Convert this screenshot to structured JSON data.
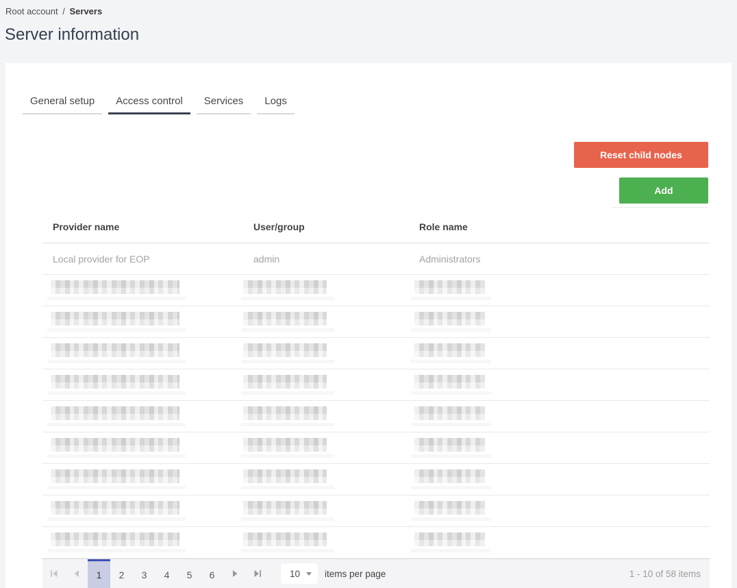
{
  "breadcrumb": {
    "parent": "Root account",
    "separator": "/",
    "current": "Servers"
  },
  "page": {
    "title": "Server information"
  },
  "tabs": [
    {
      "label": "General setup",
      "active": false
    },
    {
      "label": "Access control",
      "active": true
    },
    {
      "label": "Services",
      "active": false
    },
    {
      "label": "Logs",
      "active": false
    }
  ],
  "actions": {
    "reset": "Reset child nodes",
    "add": "Add"
  },
  "grid": {
    "columns": [
      "Provider name",
      "User/group",
      "Role name"
    ],
    "rows": [
      {
        "provider_name": "Local provider for EOP",
        "user_group": "admin",
        "role_name": "Administrators",
        "redacted": false
      },
      {
        "redacted": true
      },
      {
        "redacted": true
      },
      {
        "redacted": true
      },
      {
        "redacted": true
      },
      {
        "redacted": true
      },
      {
        "redacted": true
      },
      {
        "redacted": true
      },
      {
        "redacted": true
      },
      {
        "redacted": true
      }
    ]
  },
  "pager": {
    "pages": [
      "1",
      "2",
      "3",
      "4",
      "5",
      "6"
    ],
    "current_page": "1",
    "page_size": "10",
    "items_per_page_label": "items per page",
    "range_label": "1 - 10 of 58 items"
  },
  "colors": {
    "reset_button": "#e7634c",
    "add_button": "#4caf50",
    "active_tab_underline": "#39414f",
    "selected_page_background": "#c9cde3",
    "selected_page_top_border": "#3f51b5",
    "pager_background": "#f4f4f6"
  }
}
